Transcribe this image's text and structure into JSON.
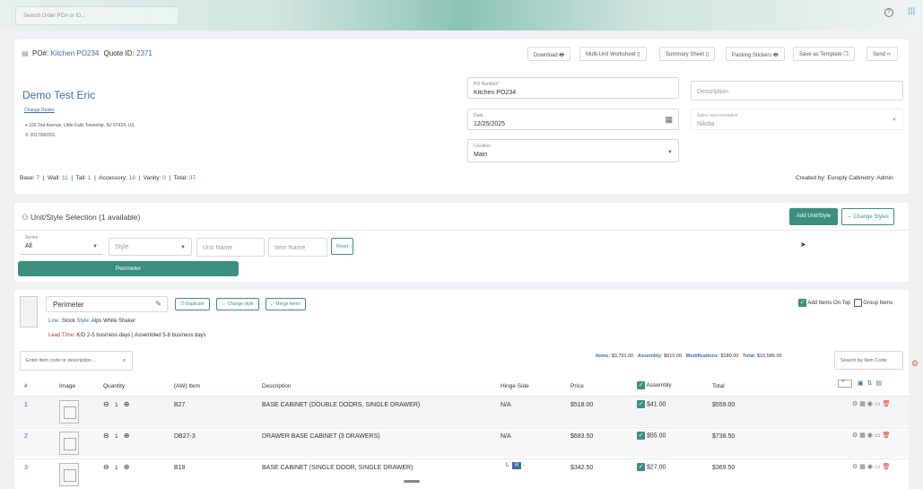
{
  "topbar": {
    "search_placeholder": "Search Order PO# or ID...",
    "help_icon": "?",
    "apps_icon": "grid-icon"
  },
  "header": {
    "po_label": "PO#:",
    "po_value": "Kitchen PO234",
    "quote_label": "Quote ID:",
    "quote_value": "2371",
    "buttons": [
      "Download",
      "Multi-Unit Worksheet",
      "Summary Sheet",
      "Packing Stickers",
      "Save as Template",
      "Send"
    ]
  },
  "customer": {
    "name": "Demo Test Eric",
    "change_dealer": "Change Dealer",
    "address": "100 2nd Avenue, Little Falls Township, NJ 07424, US",
    "phone": "2017900301"
  },
  "form": {
    "po_number_label": "PO Number*",
    "po_number": "Kitchen PO234",
    "date_label": "Date",
    "date": "12/25/2025",
    "location_label": "Location",
    "location": "Main",
    "description_placeholder": "Description",
    "sales_rep_label": "Sales representative",
    "sales_rep": "Nikola"
  },
  "counts": {
    "base_label": "Base:",
    "base": "7",
    "wall_label": "Wall:",
    "wall": "11",
    "tall_label": "Tall:",
    "tall": "1",
    "acc_label": "Accessory:",
    "acc": "18",
    "vanity_label": "Vanity:",
    "vanity": "0",
    "total_label": "Total:",
    "total": "37",
    "created_by": "Created by: Europly Cabinetry: Admin"
  },
  "unit_selection": {
    "title": "Unit/Style Selection (1 available)",
    "add_button": "Add Unit/Style",
    "change_button": "Change Styles",
    "series_label": "Series",
    "series_value": "All",
    "style_placeholder": "Style",
    "unit_name_placeholder": "Unit Name",
    "item_name_placeholder": "Item Name",
    "reset": "Reset",
    "chip": "Perimeter"
  },
  "unit": {
    "name": "Perimeter",
    "duplicate": "Duplicate",
    "change_style": "Change style",
    "merge_items": "Merge items",
    "line_label": "Line:",
    "line": "Stock",
    "style_label": "Style:",
    "style": "Alps White Shaker",
    "lead_label": "Lead Time:",
    "lead": "K/D 2-5 business days | Assembled 5-8 business days",
    "add_on_top": "Add Items On Top",
    "group_items": "Group Items",
    "item_search_placeholder": "Enter item code or description...",
    "search_code_placeholder": "Search by Item Code",
    "items_label": "Items:",
    "items_total": "$3,791.00",
    "assembly_label": "Assembly:",
    "assembly_total": "$615.00",
    "mods_label": "Modifications:",
    "mods_total": "$180.00",
    "total_label": "Total:",
    "grand_total": "$10,586.00"
  },
  "table": {
    "headers": [
      "#",
      "Image",
      "Quantity",
      "(AW) Item",
      "Description",
      "Hinge Side",
      "Price",
      "Assembly",
      "Total"
    ],
    "rows": [
      {
        "num": "1",
        "qty": "1",
        "item": "B27",
        "desc": "BASE CABINET (DOUBLE DOORS, SINGLE DRAWER)",
        "hinge": "N/A",
        "price": "$518.00",
        "assembly": "$41.00",
        "total": "$559.00"
      },
      {
        "num": "2",
        "qty": "1",
        "item": "DB27-3",
        "desc": "DRAWER BASE CABINET (3 DRAWERS)",
        "hinge": "N/A",
        "price": "$683.50",
        "assembly": "$55.00",
        "total": "$738.50"
      },
      {
        "num": "3",
        "qty": "1",
        "item": "B18",
        "desc": "BASE CABINET (SINGLE DOOR, SINGLE DRAWER)",
        "hinge": "",
        "hinge_l": "L",
        "hinge_r": "R",
        "price": "$342.50",
        "assembly": "$27.00",
        "total": "$369.50"
      }
    ]
  }
}
